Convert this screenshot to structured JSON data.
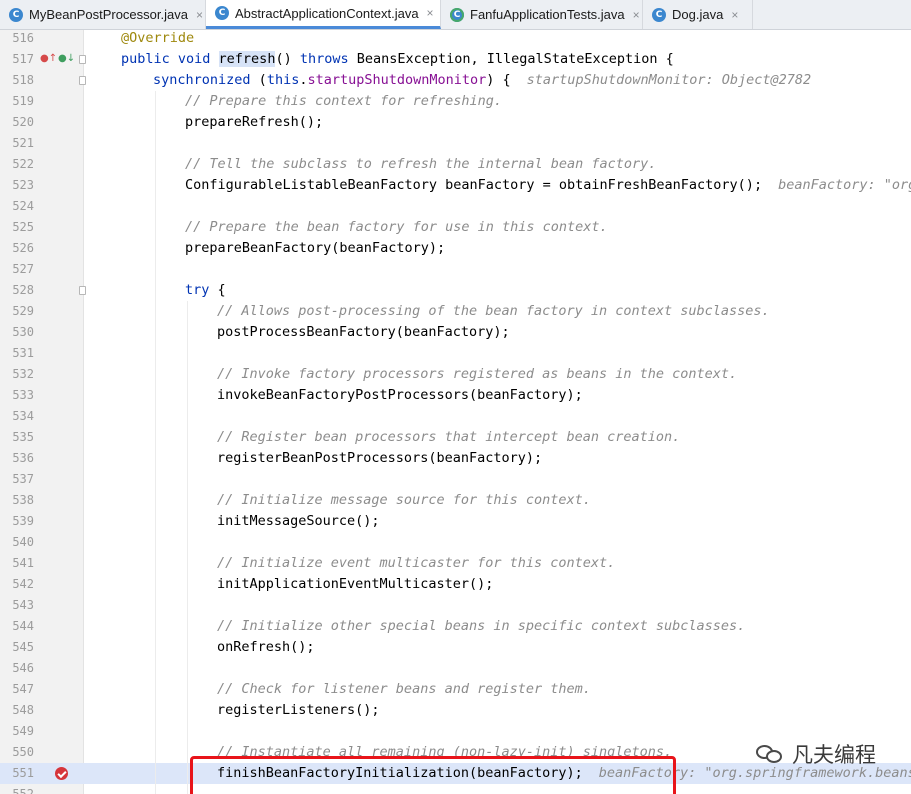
{
  "tabs": [
    {
      "label": "MyBeanPostProcessor.java",
      "icon": "class-c-icon",
      "active": false
    },
    {
      "label": "AbstractApplicationContext.java",
      "icon": "class-c-icon",
      "active": true
    },
    {
      "label": "FanfuApplicationTests.java",
      "icon": "test-class-icon",
      "active": false
    },
    {
      "label": "Dog.java",
      "icon": "class-c-icon",
      "active": false
    }
  ],
  "tab_close_glyph": "×",
  "lines": [
    {
      "num": "516",
      "indent": 4,
      "parts": [
        {
          "t": "@Override",
          "c": "ann"
        }
      ]
    },
    {
      "num": "517",
      "indent": 4,
      "icons": true,
      "fold": true,
      "parts": [
        {
          "t": "public void ",
          "c": "kw"
        },
        {
          "t": "refresh",
          "c": "hl"
        },
        {
          "t": "() ",
          "c": ""
        },
        {
          "t": "throws ",
          "c": "kw"
        },
        {
          "t": "BeansException, IllegalStateException {",
          "c": ""
        }
      ]
    },
    {
      "num": "518",
      "indent": 8,
      "fold": true,
      "parts": [
        {
          "t": "synchronized ",
          "c": "kw"
        },
        {
          "t": "(",
          "c": ""
        },
        {
          "t": "this",
          "c": "kw"
        },
        {
          "t": ".",
          "c": ""
        },
        {
          "t": "startupShutdownMonitor",
          "c": "fld"
        },
        {
          "t": ") {",
          "c": ""
        }
      ],
      "hint": "startupShutdownMonitor: Object@2782"
    },
    {
      "num": "519",
      "indent": 12,
      "parts": [
        {
          "t": "// Prepare this context for refreshing.",
          "c": "cmt"
        }
      ]
    },
    {
      "num": "520",
      "indent": 12,
      "parts": [
        {
          "t": "prepareRefresh();",
          "c": ""
        }
      ]
    },
    {
      "num": "521",
      "indent": 12,
      "parts": []
    },
    {
      "num": "522",
      "indent": 12,
      "parts": [
        {
          "t": "// Tell the subclass to refresh the internal bean factory.",
          "c": "cmt"
        }
      ]
    },
    {
      "num": "523",
      "indent": 12,
      "parts": [
        {
          "t": "ConfigurableListableBeanFactory beanFactory = obtainFreshBeanFactory();",
          "c": ""
        }
      ],
      "hint": "beanFactory: \"org."
    },
    {
      "num": "524",
      "indent": 12,
      "parts": []
    },
    {
      "num": "525",
      "indent": 12,
      "parts": [
        {
          "t": "// Prepare the bean factory for use in this context.",
          "c": "cmt"
        }
      ]
    },
    {
      "num": "526",
      "indent": 12,
      "parts": [
        {
          "t": "prepareBeanFactory(beanFactory);",
          "c": ""
        }
      ]
    },
    {
      "num": "527",
      "indent": 12,
      "parts": []
    },
    {
      "num": "528",
      "indent": 12,
      "fold": true,
      "parts": [
        {
          "t": "try ",
          "c": "kw"
        },
        {
          "t": "{",
          "c": ""
        }
      ]
    },
    {
      "num": "529",
      "indent": 16,
      "parts": [
        {
          "t": "// Allows post-processing of the bean factory in context subclasses.",
          "c": "cmt"
        }
      ]
    },
    {
      "num": "530",
      "indent": 16,
      "parts": [
        {
          "t": "postProcessBeanFactory(beanFactory);",
          "c": ""
        }
      ]
    },
    {
      "num": "531",
      "indent": 16,
      "parts": []
    },
    {
      "num": "532",
      "indent": 16,
      "parts": [
        {
          "t": "// Invoke factory processors registered as beans in the context.",
          "c": "cmt"
        }
      ]
    },
    {
      "num": "533",
      "indent": 16,
      "parts": [
        {
          "t": "invokeBeanFactoryPostProcessors(beanFactory);",
          "c": ""
        }
      ]
    },
    {
      "num": "534",
      "indent": 16,
      "parts": []
    },
    {
      "num": "535",
      "indent": 16,
      "parts": [
        {
          "t": "// Register bean processors that intercept bean creation.",
          "c": "cmt"
        }
      ]
    },
    {
      "num": "536",
      "indent": 16,
      "parts": [
        {
          "t": "registerBeanPostProcessors(beanFactory);",
          "c": ""
        }
      ]
    },
    {
      "num": "537",
      "indent": 16,
      "parts": []
    },
    {
      "num": "538",
      "indent": 16,
      "parts": [
        {
          "t": "// Initialize message source for this context.",
          "c": "cmt"
        }
      ]
    },
    {
      "num": "539",
      "indent": 16,
      "parts": [
        {
          "t": "initMessageSource();",
          "c": ""
        }
      ]
    },
    {
      "num": "540",
      "indent": 16,
      "parts": []
    },
    {
      "num": "541",
      "indent": 16,
      "parts": [
        {
          "t": "// Initialize event multicaster for this context.",
          "c": "cmt"
        }
      ]
    },
    {
      "num": "542",
      "indent": 16,
      "parts": [
        {
          "t": "initApplicationEventMulticaster();",
          "c": ""
        }
      ]
    },
    {
      "num": "543",
      "indent": 16,
      "parts": []
    },
    {
      "num": "544",
      "indent": 16,
      "parts": [
        {
          "t": "// Initialize other special beans in specific context subclasses.",
          "c": "cmt"
        }
      ]
    },
    {
      "num": "545",
      "indent": 16,
      "parts": [
        {
          "t": "onRefresh();",
          "c": ""
        }
      ]
    },
    {
      "num": "546",
      "indent": 16,
      "parts": []
    },
    {
      "num": "547",
      "indent": 16,
      "parts": [
        {
          "t": "// Check for listener beans and register them.",
          "c": "cmt"
        }
      ]
    },
    {
      "num": "548",
      "indent": 16,
      "parts": [
        {
          "t": "registerListeners();",
          "c": ""
        }
      ]
    },
    {
      "num": "549",
      "indent": 16,
      "parts": []
    },
    {
      "num": "550",
      "indent": 16,
      "parts": [
        {
          "t": "// Instantiate all remaining (non-lazy-init) singletons.",
          "c": "cmt"
        }
      ]
    },
    {
      "num": "551",
      "indent": 16,
      "exec": true,
      "breakpoint": true,
      "parts": [
        {
          "t": "finishBeanFactoryInitialization(beanFactory);",
          "c": ""
        }
      ],
      "hint": "beanFactory: \"org.springframework.beans."
    },
    {
      "num": "552",
      "indent": 16,
      "parts": []
    }
  ],
  "watermark": {
    "text": "凡夫编程",
    "icon": "wechat-icon"
  },
  "colors": {
    "keyword": "#0033b3",
    "field": "#871094",
    "comment": "#8c8c8c",
    "annotation": "#9e880d",
    "exec_line": "#dce6f9",
    "highlight_box": "#e8141a",
    "breakpoint": "#d6353b"
  }
}
